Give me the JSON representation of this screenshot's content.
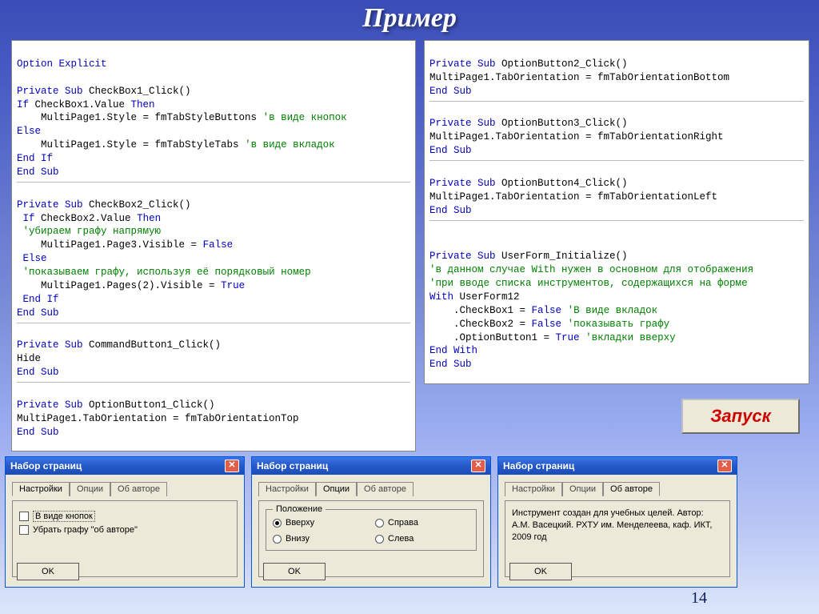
{
  "title": "Пример",
  "pageNumber": "14",
  "launchLabel": "Запуск",
  "codeLeft": {
    "l0": "Option Explicit",
    "l1": "Private Sub",
    "l1b": " CheckBox1_Click()",
    "l2a": "If",
    "l2b": " CheckBox1.Value ",
    "l2c": "Then",
    "l3a": "    MultiPage1.Style = fmTabStyleButtons ",
    "l3c": "'в виде кнопок",
    "l4": "Else",
    "l5a": "    MultiPage1.Style = fmTabStyleTabs ",
    "l5c": "'в виде вкладок",
    "l6": "End If",
    "l7": "End Sub",
    "l8": "Private Sub",
    "l8b": " CheckBox2_Click()",
    "l9a": " If",
    "l9b": " CheckBox2.Value ",
    "l9c": "Then",
    "l10": " 'убираем графу напрямую",
    "l11a": "    MultiPage1.Page3.Visible = ",
    "l11b": "False",
    "l12": " Else",
    "l13": " 'показываем графу, используя её порядковый номер",
    "l14a": "    MultiPage1.Pages(2).Visible = ",
    "l14b": "True",
    "l15": " End If",
    "l16": "End Sub",
    "l17": "Private Sub",
    "l17b": " CommandButton1_Click()",
    "l18": "Hide",
    "l19": "End Sub",
    "l20": "Private Sub",
    "l20b": " OptionButton1_Click()",
    "l21": "MultiPage1.TabOrientation = fmTabOrientationTop",
    "l22": "End Sub"
  },
  "codeRight": {
    "r0": "Private Sub",
    "r0b": " OptionButton2_Click()",
    "r1": "MultiPage1.TabOrientation = fmTabOrientationBottom",
    "r2": "End Sub",
    "r3": "Private Sub",
    "r3b": " OptionButton3_Click()",
    "r4": "MultiPage1.TabOrientation = fmTabOrientationRight",
    "r5": "End Sub",
    "r6": "Private Sub",
    "r6b": " OptionButton4_Click()",
    "r7": "MultiPage1.TabOrientation = fmTabOrientationLeft",
    "r8": "End Sub",
    "r9": "Private Sub",
    "r9b": " UserForm_Initialize()",
    "r10": "'в данном случае With нужен в основном для отображения",
    "r11": "'при вводе списка инструментов, содержащихся на форме",
    "r12a": "With",
    "r12b": " UserForm12",
    "r13a": "    .CheckBox1 = ",
    "r13b": "False ",
    "r13c": "'В виде вкладок",
    "r14a": "    .CheckBox2 = ",
    "r14b": "False ",
    "r14c": "'показывать графу",
    "r15a": "    .OptionButton1 = ",
    "r15b": "True ",
    "r15c": "'вкладки вверху",
    "r16": "End With",
    "r17": "End Sub"
  },
  "dialogs": {
    "title": "Набор страниц",
    "tabs": {
      "t1": "Настройки",
      "t2": "Опции",
      "t3": "Об авторе"
    },
    "ok": "OK",
    "d1": {
      "chk1": "В виде кнопок",
      "chk2": "Убрать графу \"об авторе\""
    },
    "d2": {
      "groupTitle": "Положение",
      "opt1": "Вверху",
      "opt2": "Справа",
      "opt3": "Внизу",
      "opt4": "Слева"
    },
    "d3": {
      "about": "Инструмент создан для учебных целей. Автор: А.М. Васецкий. РХТУ им. Менделеева, каф. ИКТ, 2009 год"
    }
  }
}
